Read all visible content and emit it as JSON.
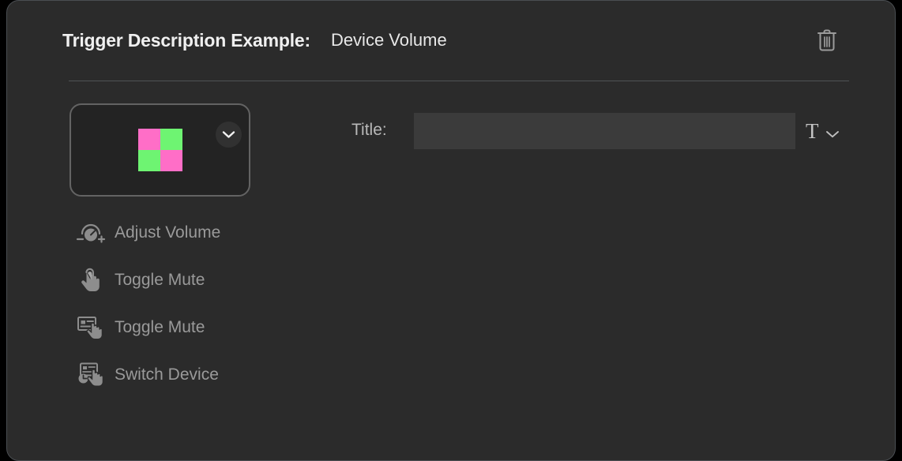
{
  "panel": {
    "background_color": "#2b2b2b",
    "border_color": "#4a4e52"
  },
  "header": {
    "title": "Trigger Description Example:",
    "value": "Device Volume",
    "delete_icon": "trash-icon"
  },
  "preview": {
    "chevron_icon": "chevron-down-icon",
    "swatch_colors": [
      "#ff6ec7",
      "#6ef472",
      "#6ef472",
      "#ff6ec7"
    ]
  },
  "actions": [
    {
      "icon": "volume-knob-icon",
      "label": "Adjust Volume"
    },
    {
      "icon": "tap-hand-icon",
      "label": "Toggle Mute"
    },
    {
      "icon": "tap-card-icon",
      "label": "Toggle Mute"
    },
    {
      "icon": "tap-card-clock-icon",
      "label": "Switch Device"
    }
  ],
  "form": {
    "title_label": "Title:",
    "title_value": "",
    "title_placeholder": "",
    "text_style_glyph": "T",
    "text_style_chevron_icon": "chevron-down-icon"
  }
}
